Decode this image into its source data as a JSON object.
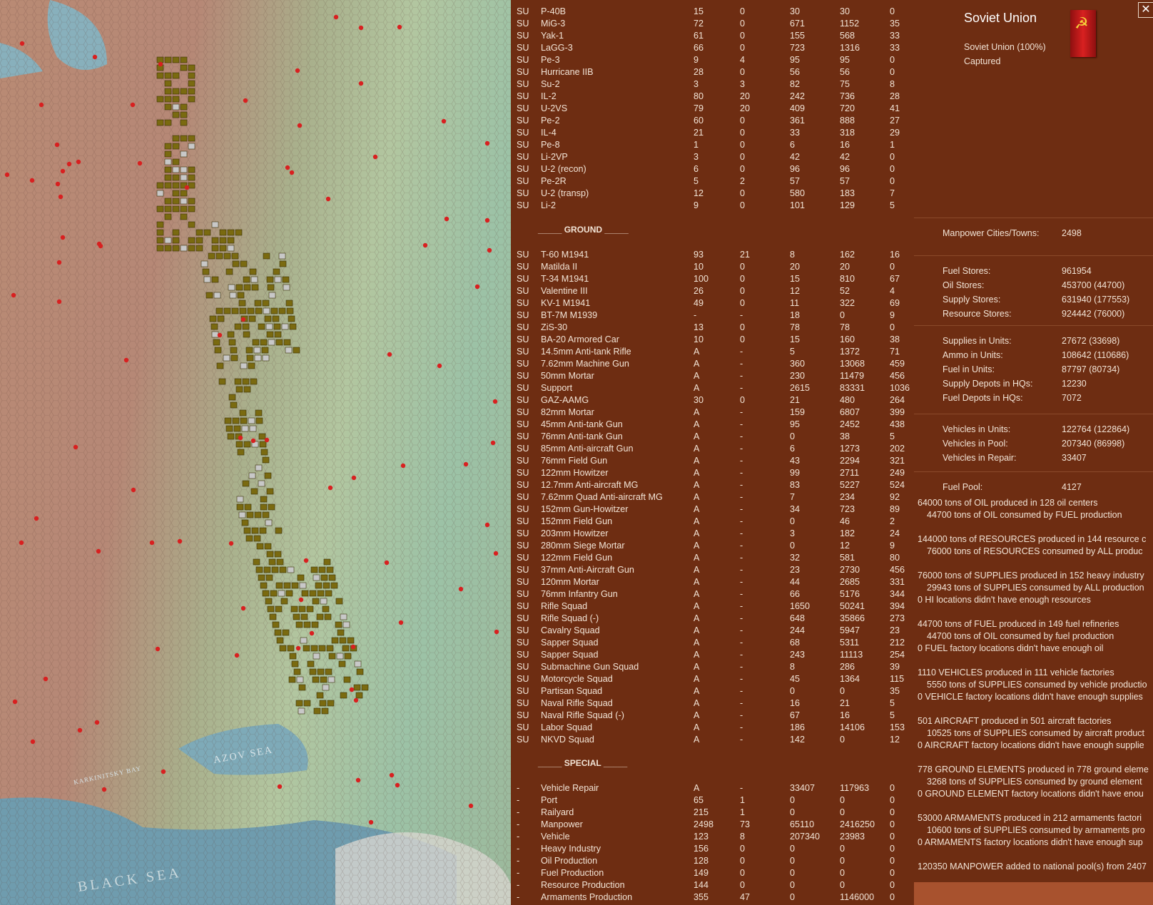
{
  "nation": {
    "title": "Soviet Union",
    "share": "Soviet Union  (100%)",
    "status": "Captured",
    "flag_color": "#c81818",
    "flag_icon": "hammer-sickle-icon"
  },
  "map_labels": [
    "BLACK SEA",
    "AZOV SEA",
    "KARKINITSKY BAY"
  ],
  "sections": {
    "ground": "_____ GROUND _____",
    "special": "_____ SPECIAL _____"
  },
  "air": [
    [
      "SU",
      "P-40B",
      "15",
      "0",
      "30",
      "30",
      "0"
    ],
    [
      "SU",
      "MiG-3",
      "72",
      "0",
      "671",
      "1152",
      "35"
    ],
    [
      "SU",
      "Yak-1",
      "61",
      "0",
      "155",
      "568",
      "33"
    ],
    [
      "SU",
      "LaGG-3",
      "66",
      "0",
      "723",
      "1316",
      "33"
    ],
    [
      "SU",
      "Pe-3",
      "9",
      "4",
      "95",
      "95",
      "0"
    ],
    [
      "SU",
      "Hurricane IIB",
      "28",
      "0",
      "56",
      "56",
      "0"
    ],
    [
      "SU",
      "Su-2",
      "3",
      "3",
      "82",
      "75",
      "8"
    ],
    [
      "SU",
      "IL-2",
      "80",
      "20",
      "242",
      "736",
      "28"
    ],
    [
      "SU",
      "U-2VS",
      "79",
      "20",
      "409",
      "720",
      "41"
    ],
    [
      "SU",
      "Pe-2",
      "60",
      "0",
      "361",
      "888",
      "27"
    ],
    [
      "SU",
      "IL-4",
      "21",
      "0",
      "33",
      "318",
      "29"
    ],
    [
      "SU",
      "Pe-8",
      "1",
      "0",
      "6",
      "16",
      "1"
    ],
    [
      "SU",
      "Li-2VP",
      "3",
      "0",
      "42",
      "42",
      "0"
    ],
    [
      "SU",
      "U-2 (recon)",
      "6",
      "0",
      "96",
      "96",
      "0"
    ],
    [
      "SU",
      "Pe-2R",
      "5",
      "2",
      "57",
      "57",
      "0"
    ],
    [
      "SU",
      "U-2 (transp)",
      "12",
      "0",
      "580",
      "183",
      "7"
    ],
    [
      "SU",
      "Li-2",
      "9",
      "0",
      "101",
      "129",
      "5"
    ]
  ],
  "ground": [
    [
      "SU",
      "T-60 M1941",
      "93",
      "21",
      "8",
      "162",
      "16"
    ],
    [
      "SU",
      "Matilda II",
      "10",
      "0",
      "20",
      "20",
      "0"
    ],
    [
      "SU",
      "T-34 M1941",
      "100",
      "0",
      "15",
      "810",
      "67"
    ],
    [
      "SU",
      "Valentine III",
      "26",
      "0",
      "12",
      "52",
      "4"
    ],
    [
      "SU",
      "KV-1 M1941",
      "49",
      "0",
      "11",
      "322",
      "69"
    ],
    [
      "SU",
      "BT-7M M1939",
      "-",
      "-",
      "18",
      "0",
      "9"
    ],
    [
      "SU",
      "ZiS-30",
      "13",
      "0",
      "78",
      "78",
      "0"
    ],
    [
      "SU",
      "BA-20 Armored Car",
      "10",
      "0",
      "15",
      "160",
      "38"
    ],
    [
      "SU",
      "14.5mm Anti-tank Rifle",
      "A",
      "-",
      "5",
      "1372",
      "71"
    ],
    [
      "SU",
      "7.62mm Machine Gun",
      "A",
      "-",
      "360",
      "13068",
      "459"
    ],
    [
      "SU",
      "50mm Mortar",
      "A",
      "-",
      "230",
      "11479",
      "456"
    ],
    [
      "SU",
      "Support",
      "A",
      "-",
      "2615",
      "83331",
      "1036"
    ],
    [
      "SU",
      "GAZ-AAMG",
      "30",
      "0",
      "21",
      "480",
      "264"
    ],
    [
      "SU",
      "82mm Mortar",
      "A",
      "-",
      "159",
      "6807",
      "399"
    ],
    [
      "SU",
      "45mm Anti-tank Gun",
      "A",
      "-",
      "95",
      "2452",
      "438"
    ],
    [
      "SU",
      "76mm Anti-tank Gun",
      "A",
      "-",
      "0",
      "38",
      "5"
    ],
    [
      "SU",
      "85mm Anti-aircraft Gun",
      "A",
      "-",
      "6",
      "1273",
      "202"
    ],
    [
      "SU",
      "76mm Field Gun",
      "A",
      "-",
      "43",
      "2294",
      "321"
    ],
    [
      "SU",
      "122mm Howitzer",
      "A",
      "-",
      "99",
      "2711",
      "249"
    ],
    [
      "SU",
      "12.7mm Anti-aircraft MG",
      "A",
      "-",
      "83",
      "5227",
      "524"
    ],
    [
      "SU",
      "7.62mm Quad Anti-aircraft MG",
      "A",
      "-",
      "7",
      "234",
      "92"
    ],
    [
      "SU",
      "152mm Gun-Howitzer",
      "A",
      "-",
      "34",
      "723",
      "89"
    ],
    [
      "SU",
      "152mm Field Gun",
      "A",
      "-",
      "0",
      "46",
      "2"
    ],
    [
      "SU",
      "203mm Howitzer",
      "A",
      "-",
      "3",
      "182",
      "24"
    ],
    [
      "SU",
      "280mm Siege Mortar",
      "A",
      "-",
      "0",
      "12",
      "9"
    ],
    [
      "SU",
      "122mm Field Gun",
      "A",
      "-",
      "32",
      "581",
      "80"
    ],
    [
      "SU",
      "37mm Anti-Aircraft Gun",
      "A",
      "-",
      "23",
      "2730",
      "456"
    ],
    [
      "SU",
      "120mm Mortar",
      "A",
      "-",
      "44",
      "2685",
      "331"
    ],
    [
      "SU",
      "76mm Infantry Gun",
      "A",
      "-",
      "66",
      "5176",
      "344"
    ],
    [
      "SU",
      "Rifle Squad",
      "A",
      "-",
      "1650",
      "50241",
      "394"
    ],
    [
      "SU",
      "Rifle Squad (-)",
      "A",
      "-",
      "648",
      "35866",
      "273"
    ],
    [
      "SU",
      "Cavalry Squad",
      "A",
      "-",
      "244",
      "5947",
      "23"
    ],
    [
      "SU",
      "Sapper Squad",
      "A",
      "-",
      "68",
      "5311",
      "212"
    ],
    [
      "SU",
      "Sapper Squad",
      "A",
      "-",
      "243",
      "11113",
      "254"
    ],
    [
      "SU",
      "Submachine Gun Squad",
      "A",
      "-",
      "8",
      "286",
      "39"
    ],
    [
      "SU",
      "Motorcycle Squad",
      "A",
      "-",
      "45",
      "1364",
      "115"
    ],
    [
      "SU",
      "Partisan Squad",
      "A",
      "-",
      "0",
      "0",
      "35"
    ],
    [
      "SU",
      "Naval Rifle Squad",
      "A",
      "-",
      "16",
      "21",
      "5"
    ],
    [
      "SU",
      "Naval Rifle Squad (-)",
      "A",
      "-",
      "67",
      "16",
      "5"
    ],
    [
      "SU",
      "Labor Squad",
      "A",
      "-",
      "186",
      "14106",
      "153"
    ],
    [
      "SU",
      "NKVD Squad",
      "A",
      "-",
      "142",
      "0",
      "12"
    ]
  ],
  "special": [
    [
      "-",
      "Vehicle Repair",
      "A",
      "-",
      "33407",
      "117963",
      "0"
    ],
    [
      "-",
      "Port",
      "65",
      "1",
      "0",
      "0",
      "0"
    ],
    [
      "-",
      "Railyard",
      "215",
      "1",
      "0",
      "0",
      "0"
    ],
    [
      "-",
      "Manpower",
      "2498",
      "73",
      "65110",
      "2416250",
      "0"
    ],
    [
      "-",
      "Vehicle",
      "123",
      "8",
      "207340",
      "23983",
      "0"
    ],
    [
      "-",
      "Heavy Industry",
      "156",
      "0",
      "0",
      "0",
      "0"
    ],
    [
      "-",
      "Oil Production",
      "128",
      "0",
      "0",
      "0",
      "0"
    ],
    [
      "-",
      "Fuel Production",
      "149",
      "0",
      "0",
      "0",
      "0"
    ],
    [
      "-",
      "Resource Production",
      "144",
      "0",
      "0",
      "0",
      "0"
    ],
    [
      "-",
      "Armaments Production",
      "355",
      "47",
      "0",
      "1146000",
      "0"
    ]
  ],
  "stats": [
    [
      [
        "Manpower Cities/Towns:",
        "2498"
      ]
    ],
    [
      [
        "Fuel Stores:",
        "961954"
      ],
      [
        "Oil Stores:",
        "453700 (44700)"
      ],
      [
        "Supply Stores:",
        "631940 (177553)"
      ],
      [
        "Resource Stores:",
        "924442 (76000)"
      ]
    ],
    [
      [
        "Supplies in Units:",
        "27672 (33698)"
      ],
      [
        "Ammo in Units:",
        "108642 (110686)"
      ],
      [
        "Fuel in Units:",
        "87797 (80734)"
      ],
      [
        "Supply Depots in HQs:",
        "12230"
      ],
      [
        "Fuel Depots in HQs:",
        "7072"
      ]
    ],
    [
      [
        "Vehicles in Units:",
        "122764 (122864)"
      ],
      [
        "Vehicles in Pool:",
        "207340 (86998)"
      ],
      [
        "Vehicles in Repair:",
        "33407"
      ]
    ],
    [
      [
        "Fuel Pool:",
        "4127"
      ]
    ]
  ],
  "report": [
    [
      "64000 tons of OIL produced in 128 oil centers",
      false
    ],
    [
      "44700 tons of OIL consumed by FUEL production",
      true
    ],
    [
      "",
      false
    ],
    [
      "144000 tons of RESOURCES produced in 144 resource c",
      false
    ],
    [
      "76000 tons of RESOURCES consumed by ALL produc",
      true
    ],
    [
      "",
      false
    ],
    [
      "76000 tons of SUPPLIES produced in 152 heavy industry",
      false
    ],
    [
      "29943 tons of SUPPLIES consumed by ALL production",
      true
    ],
    [
      "0 HI locations didn't have enough resources",
      false
    ],
    [
      "",
      false
    ],
    [
      "44700 tons of FUEL produced in 149 fuel refineries",
      false
    ],
    [
      "44700 tons of OIL consumed by fuel production",
      true
    ],
    [
      "0 FUEL factory locations didn't have enough oil",
      false
    ],
    [
      "",
      false
    ],
    [
      "1110 VEHICLES produced in 111 vehicle factories",
      false
    ],
    [
      "5550 tons of SUPPLIES consumed by vehicle productio",
      true
    ],
    [
      "0 VEHICLE factory locations didn't have enough supplies",
      false
    ],
    [
      "",
      false
    ],
    [
      "501 AIRCRAFT produced in 501 aircraft factories",
      false
    ],
    [
      "10525 tons of SUPPLIES consumed by aircraft product",
      true
    ],
    [
      "0 AIRCRAFT factory locations didn't have enough supplie",
      false
    ],
    [
      "",
      false
    ],
    [
      "778 GROUND ELEMENTS produced in 778 ground eleme",
      false
    ],
    [
      "3268 tons of SUPPLIES consumed by ground element",
      true
    ],
    [
      "0 GROUND ELEMENT factory locations didn't have enou",
      false
    ],
    [
      "",
      false
    ],
    [
      "53000 ARMAMENTS produced in 212 armaments factori",
      false
    ],
    [
      "10600 tons of SUPPLIES consumed by armaments pro",
      true
    ],
    [
      "0 ARMAMENTS factory locations didn't have enough sup",
      false
    ],
    [
      "",
      false
    ],
    [
      "120350 MANPOWER added to national pool(s) from 2407",
      false
    ]
  ],
  "colors": {
    "panel_bg": "#6e2d12",
    "text": "#f2e4d6",
    "unit_counter": "#7a6a10",
    "city_dot": "#d82020"
  }
}
